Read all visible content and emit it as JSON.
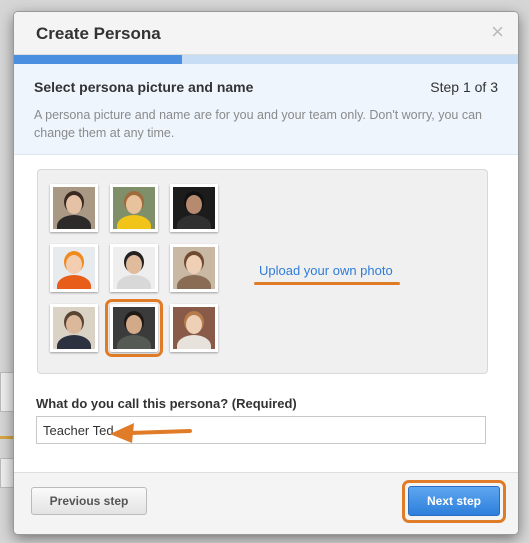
{
  "modal": {
    "title": "Create Persona",
    "close_symbol": "×",
    "progress": {
      "fraction": 0.333
    }
  },
  "step": {
    "title": "Select persona picture and name",
    "count": "Step 1 of 3",
    "description": "A persona picture and name are for you and your team only. Don't worry, you can change them at any time."
  },
  "photos": {
    "items": [
      {
        "name": "woman-dark-hair-photo",
        "bg": "#a89884",
        "head": "#e5c2a6",
        "hair": "#3a2a22",
        "shirt": "#2d2a2a"
      },
      {
        "name": "woman-yellow-top-photo",
        "bg": "#7e8f6a",
        "head": "#e8c29d",
        "hair": "#a06b3a",
        "shirt": "#f0c419"
      },
      {
        "name": "man-dark-background-photo",
        "bg": "#1c1c1c",
        "head": "#b58a6e",
        "hair": "#111111",
        "shirt": "#303030"
      },
      {
        "name": "child-pumpkin-hat-photo",
        "bg": "#e8ebee",
        "head": "#f2cdb0",
        "hair": "#f08a1c",
        "shirt": "#e95d1a"
      },
      {
        "name": "man-chef-photo",
        "bg": "#eeeeee",
        "head": "#e0bb9c",
        "hair": "#222222",
        "shirt": "#d8d8d8"
      },
      {
        "name": "woman-smiling-photo",
        "bg": "#c9b9a4",
        "head": "#efcfb5",
        "hair": "#6d4a30",
        "shirt": "#8a6c55"
      },
      {
        "name": "man-suit-photo",
        "bg": "#d9d2c5",
        "head": "#dcb89a",
        "hair": "#5a4532",
        "shirt": "#2c3240"
      },
      {
        "name": "man-hoodie-photo",
        "bg": "#3b3b3b",
        "head": "#d2aa88",
        "hair": "#1f1a16",
        "shirt": "#555a55"
      },
      {
        "name": "woman-glasses-photo",
        "bg": "#8a5a48",
        "head": "#eed0b6",
        "hair": "#b57b4c",
        "shirt": "#e7e2dc"
      }
    ],
    "selected_index": 7,
    "upload_label": "Upload your own photo"
  },
  "name_field": {
    "label": "What do you call this persona? (Required)",
    "value": "Teacher Ted"
  },
  "footer": {
    "prev_label": "Previous step",
    "next_label": "Next step"
  },
  "colors": {
    "accent_blue": "#2f7cd8",
    "annotation_orange": "#e07b27",
    "progress_fill": "#4a8fe0",
    "progress_track": "#c7dcf5"
  },
  "icons": {
    "close": "close-icon",
    "annotation_arrow": "arrow-left-icon"
  }
}
